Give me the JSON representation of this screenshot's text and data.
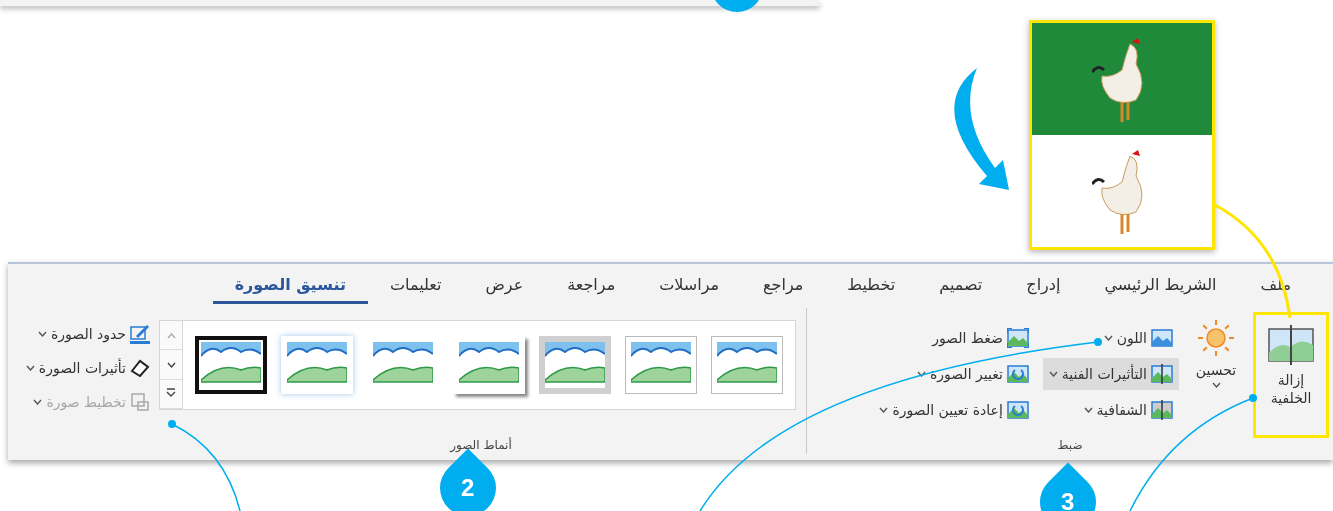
{
  "photos": [
    {
      "kind": "original"
    },
    {
      "kind": "background-removed"
    }
  ],
  "ribbon": {
    "tabs": [
      {
        "label": "ملف",
        "selected": false
      },
      {
        "label": "الشريط الرئيسي",
        "selected": false
      },
      {
        "label": "إدراج",
        "selected": false
      },
      {
        "label": "تصميم",
        "selected": false
      },
      {
        "label": "تخطيط",
        "selected": false
      },
      {
        "label": "مراجع",
        "selected": false
      },
      {
        "label": "مراسلات",
        "selected": false
      },
      {
        "label": "مراجعة",
        "selected": false
      },
      {
        "label": "عرض",
        "selected": false
      },
      {
        "label": "تعليمات",
        "selected": false
      },
      {
        "label": "تنسيق الصورة",
        "selected": true
      }
    ],
    "adjust_group": {
      "label": "ضبط",
      "remove_background": {
        "label": "إزالة الخلفية",
        "highlighted": true
      },
      "corrections": {
        "label": "تحسين"
      },
      "columns": [
        {
          "commands": [
            {
              "label": "اللون",
              "menu": true,
              "hovered": false
            },
            {
              "label": "التأثيرات الفنية",
              "menu": true,
              "hovered": true
            },
            {
              "label": "الشفافية",
              "menu": true,
              "hovered": false
            }
          ]
        },
        {
          "commands": [
            {
              "label": "ضغط الصور",
              "menu": false,
              "hovered": false
            },
            {
              "label": "تغيير الصورة",
              "menu": true,
              "hovered": false
            },
            {
              "label": "إعادة تعيين الصورة",
              "menu": true,
              "hovered": false
            }
          ]
        }
      ]
    },
    "styles_group": {
      "label": "أنماط الصور",
      "gallery": [
        {
          "kind": "thin-frame"
        },
        {
          "kind": "white-frame"
        },
        {
          "kind": "grey-frame"
        },
        {
          "kind": "drop-shadow"
        },
        {
          "kind": "rounded"
        },
        {
          "kind": "soft-edge"
        },
        {
          "kind": "black-frame"
        }
      ]
    },
    "picture_commands": [
      {
        "label": "حدود الصورة",
        "disabled": false
      },
      {
        "label": "تأثيرات الصورة",
        "disabled": false
      },
      {
        "label": "تخطيط صورة",
        "disabled": true
      }
    ]
  },
  "callouts": [
    {
      "number": "2"
    },
    {
      "number": "3"
    }
  ]
}
